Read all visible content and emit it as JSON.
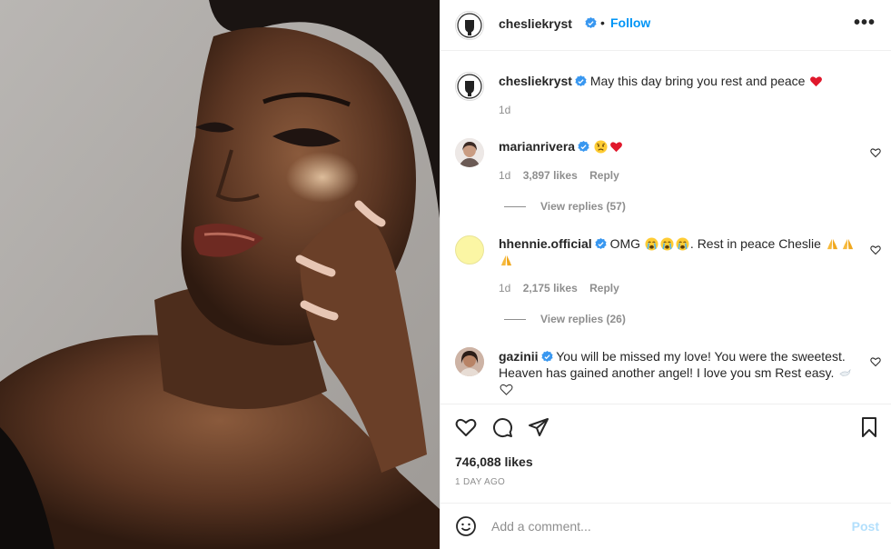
{
  "post": {
    "author": "chesliekryst",
    "follow_label": "Follow",
    "dot": "•",
    "more_label": "•••",
    "likes": "746,088 likes",
    "age": "1 DAY AGO"
  },
  "caption": {
    "username": "chesliekryst",
    "text": "May this day bring you rest and peace",
    "time": "1d"
  },
  "comments": [
    {
      "username": "marianrivera",
      "time": "1d",
      "likes": "3,897 likes",
      "reply_label": "Reply",
      "view_replies": "View replies (57)"
    },
    {
      "username": "hhennie.official",
      "text_start": "OMG",
      "text_mid": ". Rest in peace Cheslie",
      "time": "1d",
      "likes": "2,175 likes",
      "reply_label": "Reply",
      "view_replies": "View replies (26)"
    },
    {
      "username": "gazinii",
      "text_line1": "You will be missed my love! You were the sweetest.",
      "text_line2": "Heaven has gained another angel! I love you sm Rest easy."
    }
  ],
  "add_comment": {
    "placeholder": "Add a comment...",
    "post_label": "Post"
  },
  "icons": {
    "like": "heart-icon",
    "comment": "comment-icon",
    "share": "send-icon",
    "save": "bookmark-icon",
    "emoji": "smiley-icon",
    "verified": "verified-badge-icon"
  },
  "colors": {
    "link": "#0095f6",
    "verified": "#3897f0",
    "muted": "#8e8e8e",
    "post_disabled": "#b2dffc"
  }
}
